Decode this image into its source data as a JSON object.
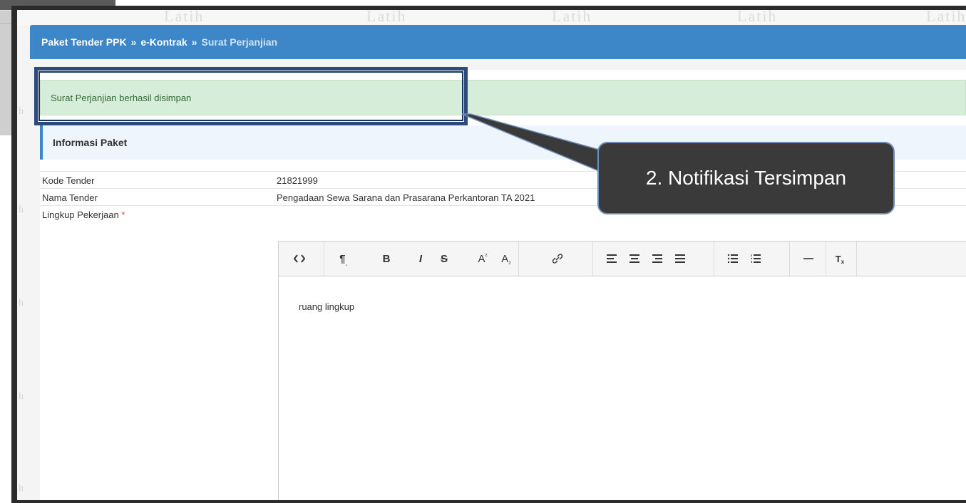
{
  "watermark": {
    "text": "Latih"
  },
  "breadcrumb": {
    "item1": "Paket Tender PPK",
    "sep": "»",
    "item2": "e-Kontrak",
    "current": "Surat Perjanjian"
  },
  "alert": {
    "message": "Surat Perjanjian berhasil disimpan"
  },
  "info_header": {
    "title": "Informasi Paket"
  },
  "fields": {
    "kode_tender": {
      "label": "Kode Tender",
      "value": "21821999"
    },
    "nama_tender": {
      "label": "Nama Tender",
      "value": "Pengadaan Sewa Sarana dan Prasarana Perkantoran TA 2021"
    },
    "lingkup": {
      "label": "Lingkup Pekerjaan",
      "required_mark": "*"
    }
  },
  "editor": {
    "toolbar": [
      "source-code-icon",
      "paragraph-format-icon",
      "bold-icon",
      "italic-icon",
      "strikethrough-icon",
      "superscript-icon",
      "subscript-icon",
      "link-icon",
      "align-left-icon",
      "align-center-icon",
      "align-right-icon",
      "align-justify-icon",
      "bullet-list-icon",
      "numbered-list-icon",
      "horizontal-rule-icon",
      "clear-format-icon"
    ],
    "content": "ruang lingkup"
  },
  "callout": {
    "text": "2. Notifikasi Tersimpan"
  },
  "colors": {
    "breadcrumb_bg": "#3d87c8",
    "alert_bg": "#d6eed9",
    "alert_text": "#2f6b33",
    "callout_bg": "#3a3a3a",
    "highlight_border": "#2e4a7a"
  }
}
